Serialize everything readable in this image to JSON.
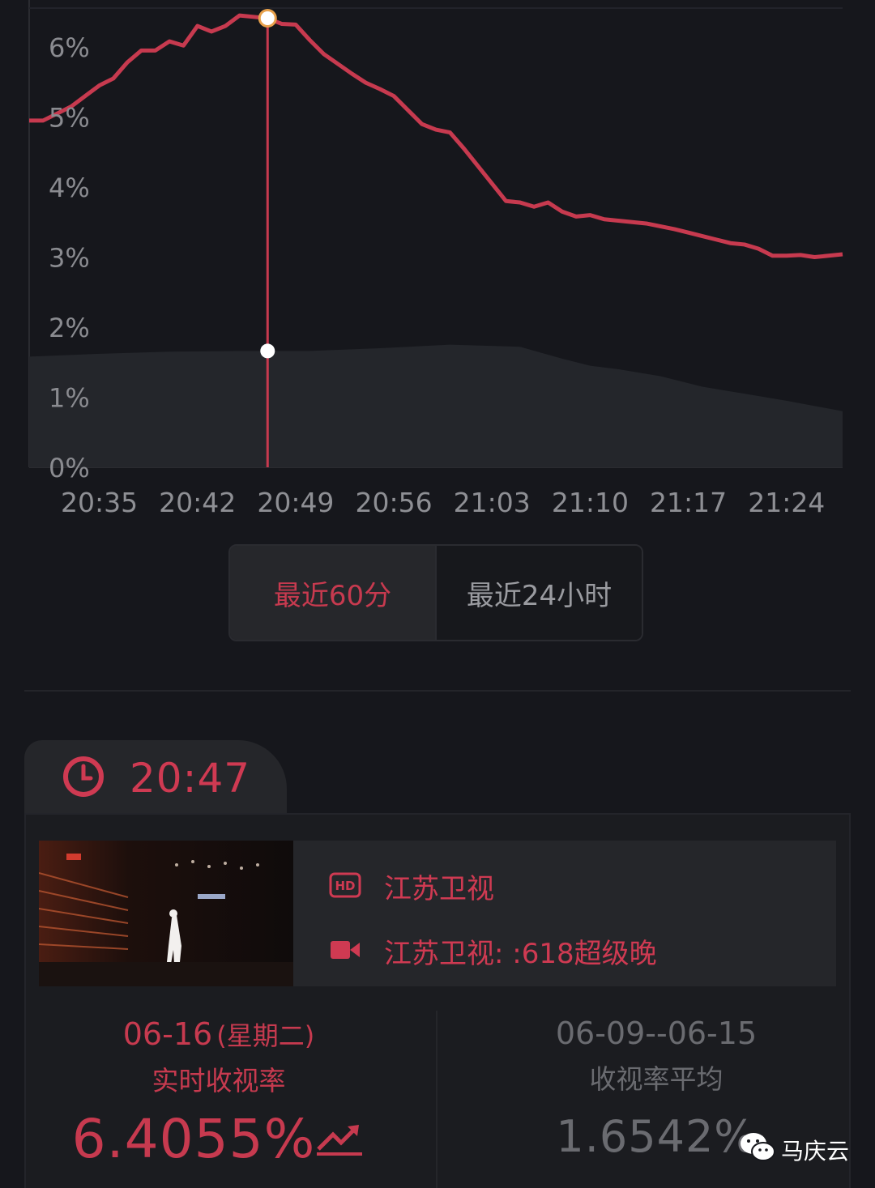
{
  "chart_data": {
    "type": "area",
    "y_ticks": [
      "6%",
      "5%",
      "4%",
      "3%",
      "2%",
      "1%",
      "0%"
    ],
    "x_ticks": [
      "20:35",
      "20:42",
      "20:49",
      "20:56",
      "21:03",
      "21:10",
      "21:17",
      "21:24"
    ],
    "ylim": [
      0,
      6.5
    ],
    "series": [
      {
        "color": "#c73a4f",
        "x": [
          "20:30",
          "20:31",
          "20:32",
          "20:33",
          "20:34",
          "20:35",
          "20:36",
          "20:37",
          "20:38",
          "20:39",
          "20:40",
          "20:41",
          "20:42",
          "20:43",
          "20:44",
          "20:45",
          "20:46",
          "20:47",
          "20:48",
          "20:49",
          "20:50",
          "20:51",
          "20:52",
          "20:53",
          "20:54",
          "20:55",
          "20:56",
          "20:57",
          "20:58",
          "20:59",
          "21:00",
          "21:01",
          "21:02",
          "21:03",
          "21:04",
          "21:05",
          "21:06",
          "21:07",
          "21:08",
          "21:09",
          "21:10",
          "21:11",
          "21:12",
          "21:13",
          "21:14",
          "21:15",
          "21:16",
          "21:17",
          "21:18",
          "21:19",
          "21:20",
          "21:21",
          "21:22",
          "21:23",
          "21:24",
          "21:25",
          "21:26",
          "21:27",
          "21:28"
        ],
        "values": [
          4.95,
          4.95,
          5.05,
          5.15,
          5.3,
          5.45,
          5.55,
          5.78,
          5.95,
          5.95,
          6.08,
          6.02,
          6.3,
          6.22,
          6.3,
          6.45,
          6.43,
          6.41,
          6.33,
          6.32,
          6.1,
          5.9,
          5.76,
          5.62,
          5.49,
          5.4,
          5.3,
          5.1,
          4.9,
          4.82,
          4.78,
          4.55,
          4.3,
          4.05,
          3.8,
          3.78,
          3.72,
          3.78,
          3.65,
          3.58,
          3.6,
          3.54,
          3.52,
          3.5,
          3.48,
          3.44,
          3.4,
          3.35,
          3.3,
          3.25,
          3.2,
          3.18,
          3.12,
          3.02,
          3.02,
          3.03,
          3.0,
          3.02,
          3.04
        ]
      },
      {
        "color": "#24262b",
        "x": [
          "20:30",
          "20:35",
          "20:40",
          "20:45",
          "20:50",
          "20:55",
          "21:00",
          "21:05",
          "21:08",
          "21:10",
          "21:12",
          "21:15",
          "21:18",
          "21:21",
          "21:24",
          "21:28"
        ],
        "values": [
          1.58,
          1.62,
          1.65,
          1.66,
          1.66,
          1.7,
          1.75,
          1.72,
          1.55,
          1.45,
          1.4,
          1.3,
          1.15,
          1.05,
          0.95,
          0.8
        ]
      }
    ],
    "selected_time": "20:47",
    "selected_values": [
      6.41,
      1.66
    ]
  },
  "range_toggle": {
    "active_label": "最近60分",
    "inactive_label": "最近24小时"
  },
  "time_tab": {
    "time": "20:47",
    "icon": "clock-icon"
  },
  "program": {
    "channel": "江苏卫视",
    "channel_icon": "hd-icon",
    "show": "江苏卫视:  :618超级晚",
    "show_icon": "video-camera-icon"
  },
  "stats": {
    "left": {
      "date": "06-16",
      "weekday": "(星期二)",
      "caption": "实时收视率",
      "value": "6.4055%",
      "trend_icon": "trend-up-icon"
    },
    "right": {
      "date_range": "06-09--06-15",
      "caption": "收视率平均",
      "value": "1.6542%"
    }
  },
  "watermark": {
    "text": "马庆云",
    "icon": "wechat-icon"
  },
  "colors": {
    "accent": "#c73a4f",
    "background": "#16171c"
  }
}
